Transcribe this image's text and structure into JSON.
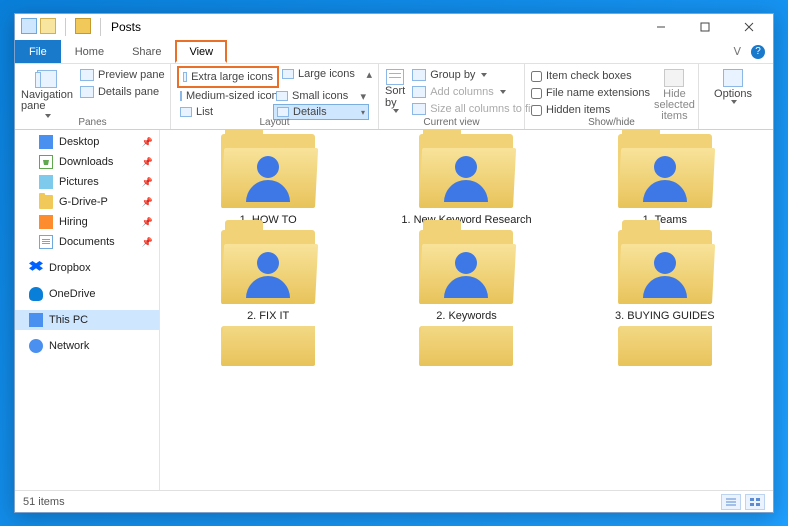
{
  "window": {
    "title": "Posts"
  },
  "menubar": {
    "file": "File",
    "tabs": [
      "Home",
      "Share",
      "View"
    ],
    "active": "View"
  },
  "ribbon": {
    "panes": {
      "title": "Panes",
      "navigation_pane": "Navigation pane",
      "preview_pane": "Preview pane",
      "details_pane": "Details pane"
    },
    "layout": {
      "title": "Layout",
      "extra_large": "Extra large icons",
      "large": "Large icons",
      "medium": "Medium-sized icons",
      "small": "Small icons",
      "list": "List",
      "details": "Details"
    },
    "current_view": {
      "title": "Current view",
      "sort_by": "Sort by",
      "group_by": "Group by",
      "add_columns": "Add columns",
      "size_columns": "Size all columns to fit"
    },
    "show_hide": {
      "title": "Show/hide",
      "item_check_boxes": "Item check boxes",
      "file_name_extensions": "File name extensions",
      "hidden_items": "Hidden items",
      "hide_selected": "Hide selected items"
    },
    "options": "Options"
  },
  "sidebar": {
    "items": [
      {
        "label": "Desktop",
        "icon": "desktop",
        "pinned": true
      },
      {
        "label": "Downloads",
        "icon": "down",
        "pinned": true
      },
      {
        "label": "Pictures",
        "icon": "pic",
        "pinned": true
      },
      {
        "label": "G-Drive-P",
        "icon": "folder",
        "pinned": true
      },
      {
        "label": "Hiring",
        "icon": "hiring",
        "pinned": true
      },
      {
        "label": "Documents",
        "icon": "doc",
        "pinned": true
      }
    ],
    "groups": [
      {
        "label": "Dropbox",
        "icon": "dropbox"
      },
      {
        "label": "OneDrive",
        "icon": "onedrive"
      },
      {
        "label": "This PC",
        "icon": "thispc",
        "selected": true
      },
      {
        "label": "Network",
        "icon": "network"
      }
    ]
  },
  "folders": {
    "row1": [
      "1. HOW TO",
      "1. New Keyword Research",
      "1. Teams"
    ],
    "row2": [
      "2. FIX IT",
      "2. Keywords",
      "3. BUYING GUIDES"
    ]
  },
  "statusbar": {
    "count": "51 items"
  }
}
